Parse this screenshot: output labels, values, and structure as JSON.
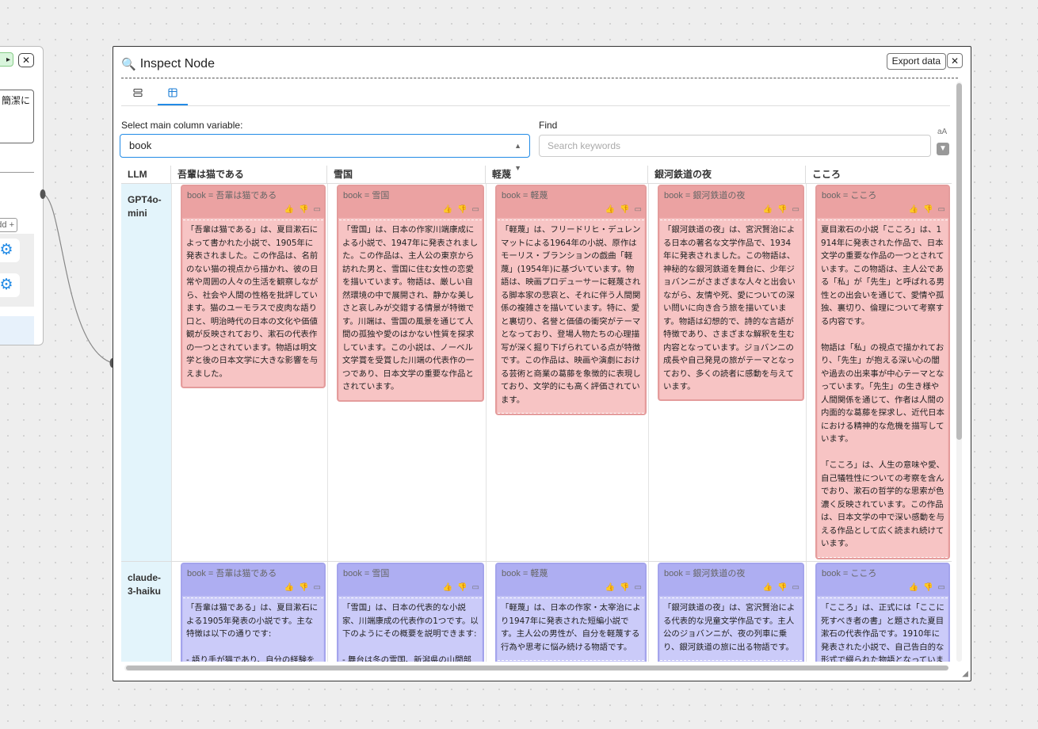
{
  "bg_node": {
    "close_label": "✕",
    "text_fragment": "簡潔に",
    "add_label": "dd +"
  },
  "modal": {
    "title": "Inspect Node",
    "export_label": "Export data",
    "close_label": "✕",
    "tabs": [
      {
        "icon": "list-layout-icon",
        "active": false
      },
      {
        "icon": "table-layout-icon",
        "active": true
      }
    ],
    "select": {
      "label": "Select main column variable:",
      "value": "book"
    },
    "find": {
      "label": "Find",
      "placeholder": "Search keywords"
    }
  },
  "table": {
    "llm_header": "LLM",
    "columns": [
      "吾輩は猫である",
      "雪国",
      "軽蔑",
      "銀河鉄道の夜",
      "こころ"
    ],
    "rows": [
      {
        "llm": "GPT4o-\nmini",
        "color": "#f3b9b9",
        "cells": [
          {
            "var": "book = 吾輩は猫である",
            "text": "「吾輩は猫である」は、夏目漱石によって書かれた小説で、1905年に発表されました。この作品は、名前のない猫の視点から描かれ、彼の日常や周囲の人々の生活を観察しながら、社会や人間の性格を批評しています。猫のユーモラスで皮肉な語り口と、明治時代の日本の文化や価値観が反映されており、漱石の代表作の一つとされています。物語は明文学と後の日本文学に大きな影響を与えました。"
          },
          {
            "var": "book = 雪国",
            "text": "「雪国」は、日本の作家川端康成による小説で、1947年に発表されました。この作品は、主人公の東京から訪れた男と、雪国に住む女性の恋愛を描いています。物語は、厳しい自然環境の中で展開され、静かな美しさと哀しみが交錯する情景が特徴です。川端は、雪国の風景を通じて人間の孤独や愛のはかない性質を探求しています。この小説は、ノーベル文学賞を受賞した川端の代表作の一つであり、日本文学の重要な作品とされています。"
          },
          {
            "var": "book = 軽蔑",
            "text": "「軽蔑」は、フリードリヒ・デュレンマットによる1964年の小説、原作はモーリス・ブランションの戯曲「軽蔑」(1954年)に基づいています。物語は、映画プロデューサーに軽蔑される脚本家の悲哀と、それに伴う人間関係の複雑さを描いています。特に、愛と裏切り、名誉と価値の衝突がテーマとなっており、登場人物たちの心理描写が深く掘り下げられている点が特徴です。この作品は、映画や演劇における芸術と商業の葛藤を象徴的に表現しており、文学的にも高く評価されています。"
          },
          {
            "var": "book = 銀河鉄道の夜",
            "text": "「銀河鉄道の夜」は、宮沢賢治による日本の著名な文学作品で、1934年に発表されました。この物語は、神秘的な銀河鉄道を舞台に、少年ジョバンニがさまざまな人々と出会いながら、友情や死、愛についての深い問いに向き合う旅を描いています。物語は幻想的で、詩的な言語が特徴であり、さまざまな解釈を生む内容となっています。ジョバンニの成長や自己発見の旅がテーマとなっており、多くの読者に感動を与えています。"
          },
          {
            "var": "book = こころ",
            "text": "夏目漱石の小説「こころ」は、1914年に発表された作品で、日本文学の重要な作品の一つとされています。この物語は、主人公である「私」が「先生」と呼ばれる男性との出会いを通じて、愛情や孤独、裏切り、倫理について考察する内容です。\n\n物語は「私」の視点で描かれており、「先生」が抱える深い心の闇や過去の出来事が中心テーマとなっています。「先生」の生き様や人間関係を通じて、作者は人間の内面的な葛藤を探求し、近代日本における精神的な危機を描写しています。\n\n「こころ」は、人生の意味や愛、自己犠牲性についての考察を含んでおり、漱石の哲学的な思索が色濃く反映されています。この作品は、日本文学の中で深い感動を与える作品として広く読まれ続けています。"
          }
        ]
      },
      {
        "llm": "claude-\n3-haiku",
        "color": "#c2c2f6",
        "cells": [
          {
            "var": "book = 吾輩は猫である",
            "text": "「吾輩は猫である」は、夏目漱石による1905年発表の小説です。主な特徴は以下の通りです:\n\n- 語り手が猫であり、自分の経験を"
          },
          {
            "var": "book = 雪国",
            "text": "「雪国」は、日本の代表的な小説家、川端康成の代表作の1つです。以下のようにその概要を説明できます:\n\n- 舞台は冬の雪国、新潟県の山間部"
          },
          {
            "var": "book = 軽蔑",
            "text": "「軽蔑」は、日本の作家・太宰治により1947年に発表された短編小説です。主人公の男性が、自分を軽蔑する行為や思考に悩み続ける物語です。"
          },
          {
            "var": "book = 銀河鉄道の夜",
            "text": "「銀河鉄道の夜」は、宮沢賢治による代表的な児童文学作品です。主人公のジョバンニが、夜の列車に乗り、銀河鉄道の旅に出る物語です。"
          },
          {
            "var": "book = こころ",
            "text": "「こころ」は、正式には「ここに死すべき者の書」と題された夏目漱石の代表作品です。1910年に発表された小説で、自己告白的な形式で綴られた物語となっていま"
          }
        ]
      }
    ]
  }
}
